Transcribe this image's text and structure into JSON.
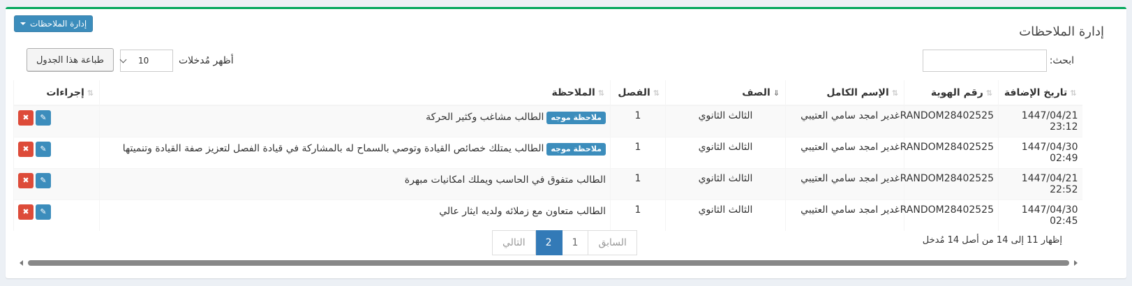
{
  "box": {
    "title": "إدارة الملاحظات",
    "mgmt_button": "إدارة الملاحظات"
  },
  "controls": {
    "search_label": "ابحث:",
    "length_label": "أظهر مُدخلات",
    "length_value": "10",
    "print_button": "طباعة هذا الجدول"
  },
  "table": {
    "headers": {
      "date": "تاريخ الإضافة",
      "id": "رقم الهوية",
      "name": "الإسم الكامل",
      "grade": "الصف",
      "class": "الفصل",
      "note": "الملاحظة",
      "actions": "إجراءات"
    },
    "rows": [
      {
        "date": "1447/04/21 23:12",
        "id": "RANDOM28402525",
        "name": "غدير امجد سامي العتيبي",
        "grade": "الثالث الثانوي",
        "class": "1",
        "badge": "ملاحظة موجه",
        "note": "الطالب مشاغب وكثير الحركة"
      },
      {
        "date": "1447/04/30 02:49",
        "id": "RANDOM28402525",
        "name": "غدير امجد سامي العتيبي",
        "grade": "الثالث الثانوي",
        "class": "1",
        "badge": "ملاحظة موجه",
        "note": "الطالب يمتلك خصائص القيادة وتوصي بالسماح له بالمشاركة في قيادة الفصل لتعزيز صفة القيادة وتنميتها"
      },
      {
        "date": "1447/04/21 22:52",
        "id": "RANDOM28402525",
        "name": "غدير امجد سامي العتيبي",
        "grade": "الثالث الثانوي",
        "class": "1",
        "badge": "",
        "note": "الطالب متفوق في الحاسب ويملك امكانيات مبهرة"
      },
      {
        "date": "1447/04/30 02:45",
        "id": "RANDOM28402525",
        "name": "غدير امجد سامي العتيبي",
        "grade": "الثالث الثانوي",
        "class": "1",
        "badge": "",
        "note": "الطالب متعاون مع زملائه ولديه ايثار عالي"
      }
    ]
  },
  "footer": {
    "info": "إظهار 11 إلى 14 من أصل 14 مُدخل",
    "prev": "السابق",
    "page1": "1",
    "page2": "2",
    "next": "التالي"
  },
  "colors": {
    "accent": "#3c8dbc",
    "danger": "#dd4b39",
    "top_border": "#00a65a"
  },
  "icons": {
    "edit": "pencil-icon",
    "delete": "times-icon",
    "sort": "sort-icon"
  }
}
